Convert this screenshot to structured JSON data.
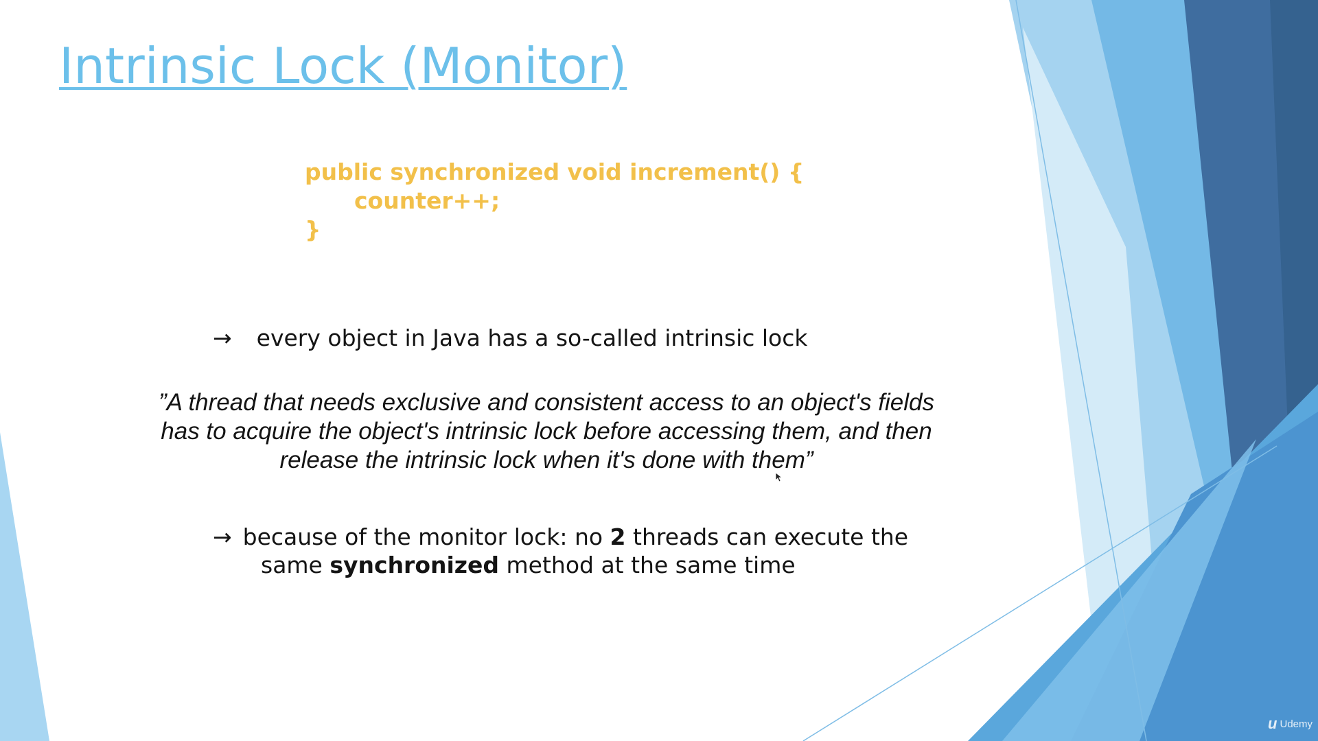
{
  "slide": {
    "title": "Intrinsic Lock (Monitor)",
    "code": {
      "line1": "public synchronized void increment() {",
      "line2": "counter++;",
      "line3": "}"
    },
    "bullet1": {
      "arrow": "→",
      "text": "every object in Java has a so-called intrinsic lock"
    },
    "quote": {
      "line1": "”A thread that needs exclusive and consistent access to an object's fields",
      "line2": "has to acquire the object's intrinsic lock before accessing them, and then",
      "line3": "release the intrinsic lock when it's done with them”"
    },
    "bullet2": {
      "arrow": "→",
      "text_before": "because of the monitor lock: no ",
      "bold_number": "2",
      "text_after": " threads can execute the",
      "cont_before": "same ",
      "cont_bold": "synchronized",
      "cont_after": " method at the same time"
    }
  },
  "watermark": {
    "text": "Udemy",
    "icon": "udemy-logo-icon"
  },
  "colors": {
    "title": "#6cc0ea",
    "code": "#f2c04a",
    "text": "#141414",
    "decor_light": "#a8d6f2",
    "decor_mid": "#6fb9e6",
    "decor_dark": "#3f6d9f"
  }
}
